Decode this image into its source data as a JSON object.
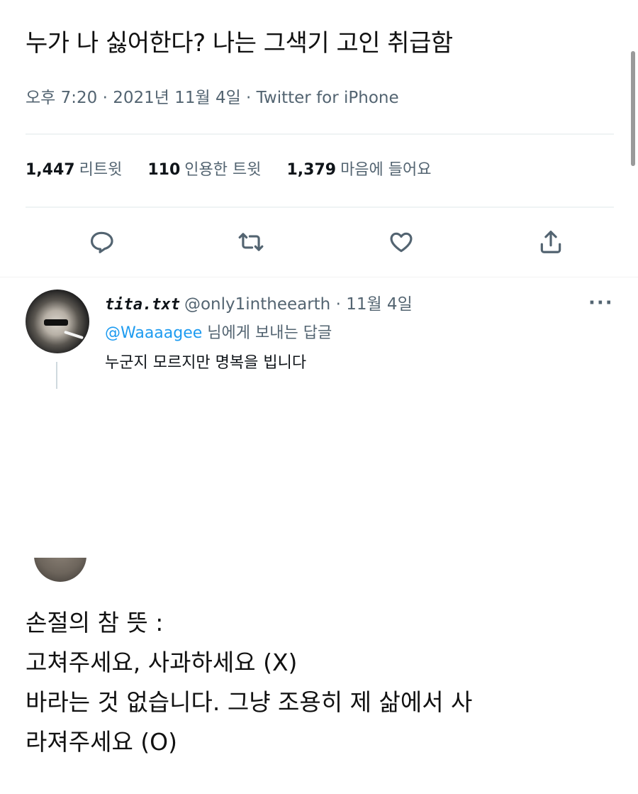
{
  "tweet": {
    "text": "누가 나 싫어한다? 나는 그색기 고인 취급함",
    "meta": "오후 7:20 · 2021년 11월 4일 · Twitter for iPhone"
  },
  "stats": [
    {
      "num": "1,447",
      "label": "리트윗"
    },
    {
      "num": "110",
      "label": "인용한 트윗"
    },
    {
      "num": "1,379",
      "label": "마음에 들어요"
    }
  ],
  "actions": [
    "reply-icon",
    "retweet-icon",
    "like-icon",
    "share-icon"
  ],
  "reply": {
    "name": "tita.txt",
    "handle": "@only1intheearth · 11월 4일",
    "more": "···",
    "replying_mention": "@Waaaagee",
    "replying_suffix": " 님에게 보내는 답글",
    "body": "누군지 모르지만 명복을 빕니다"
  },
  "caption": {
    "line1": "손절의 참 뜻 :",
    "line2": "고쳐주세요, 사과하세요 (X)",
    "line3": "바라는 것 없습니다. 그냥 조용히 제 삶에서 사",
    "line4": "라져주세요 (O)"
  },
  "colors": {
    "secondary_text": "#536471",
    "mention": "#1d9bf0",
    "divider": "#eff3f4"
  }
}
